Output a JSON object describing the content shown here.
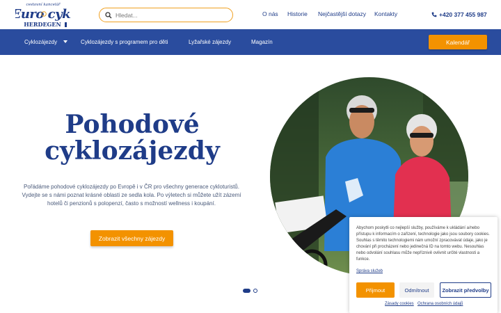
{
  "logo": {
    "tagline": "cestovní kancelář",
    "brand": "Euro cykl",
    "owner": "HERDEGEN"
  },
  "search": {
    "placeholder": "Hledat..."
  },
  "topnav": {
    "items": [
      "O nás",
      "Historie",
      "Nejčastější dotazy",
      "Kontakty"
    ],
    "phone": "+420 377 455 987"
  },
  "mainnav": {
    "items": [
      "Cyklozájezdy",
      "Cyklozájezdy s programem pro děti",
      "Lyžařské zájezdy",
      "Magazín"
    ],
    "calendar_label": "Kalendář"
  },
  "hero": {
    "title_line1": "Pohodové",
    "title_line2": "cyklozájezdy",
    "description": "Pořádáme pohodové cyklozájezdy po Evropě i v ČR pro všechny generace cykloturistů. Vydejte se s námi poznat krásné oblasti ze sedla kola. Po výletech si můžete užít zázemí hotelů či penzionů s polopenzí, často s možností wellness i koupání.",
    "cta_label": "Zobrazit všechny zájezdy",
    "slides_total": 2,
    "slide_current": 1
  },
  "cookie": {
    "text": "Abychom poskytli co nejlepší služby, používáme k ukládání a/nebo přístupu k informacím o zařízení, technologie jako jsou soubory cookies. Souhlas s těmito technologiemi nám umožní zpracovávat údaje, jako je chování při procházení nebo jedinečná ID na tomto webu. Nesouhlas nebo odvolání souhlasu může nepříznivě ovlivnit určité vlastnosti a funkce.",
    "manage_label": "Správa služeb",
    "accept_label": "Přijmout",
    "deny_label": "Odmítnout",
    "prefs_label": "Zobrazit předvolby",
    "policy_link": "Zásady cookies",
    "privacy_link": "Ochrana osobních údajů"
  },
  "colors": {
    "brand_blue": "#1f3c88",
    "nav_blue": "#2a4c9e",
    "accent_orange": "#f39200"
  },
  "icons": [
    "search-icon",
    "phone-icon",
    "chevron-down-icon"
  ]
}
